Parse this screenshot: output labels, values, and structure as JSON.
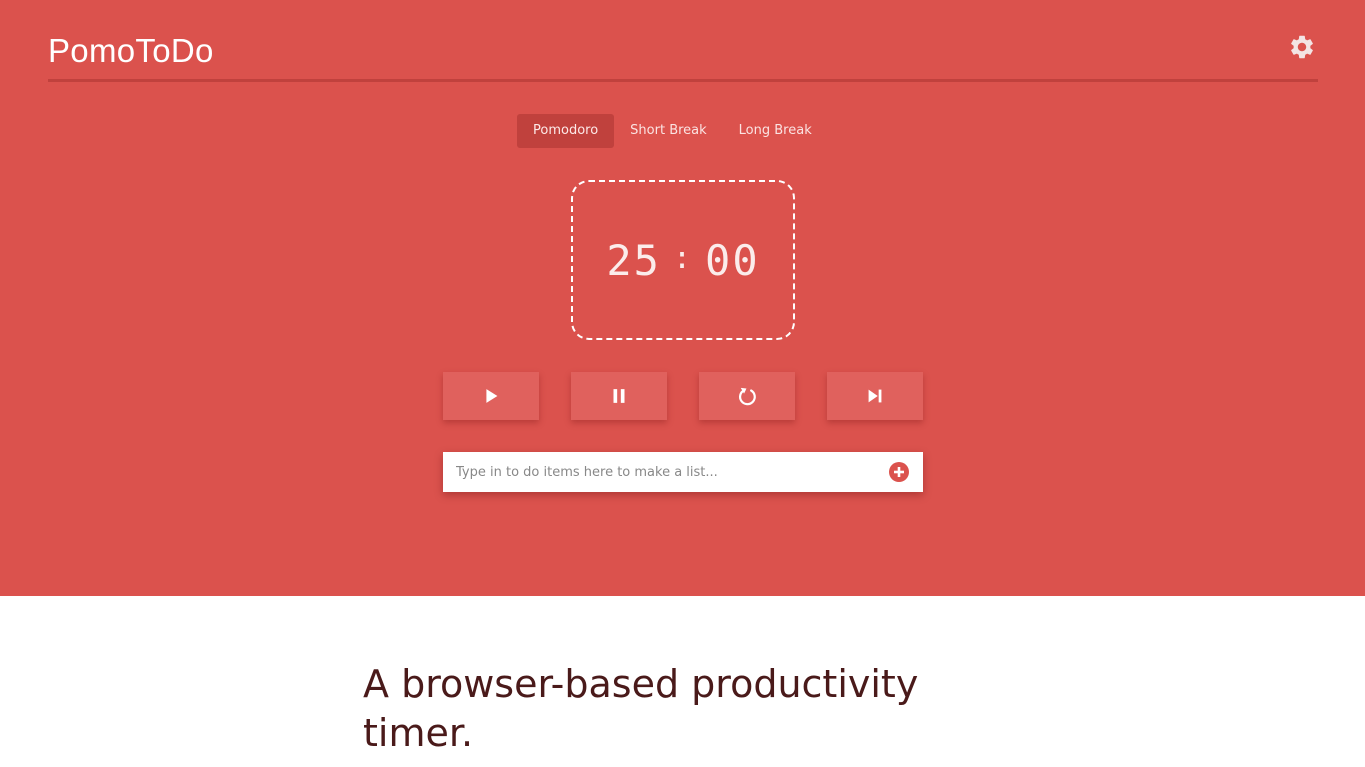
{
  "header": {
    "brand_part1": "Pomo",
    "brand_part2": "ToDo",
    "settings_icon": "gear-icon"
  },
  "tabs": [
    {
      "label": "Pomodoro",
      "active": true
    },
    {
      "label": "Short Break",
      "active": false
    },
    {
      "label": "Long Break",
      "active": false
    }
  ],
  "timer": {
    "minutes": "25",
    "separator": ":",
    "seconds": "00"
  },
  "controls": [
    {
      "icon": "play-icon"
    },
    {
      "icon": "pause-icon"
    },
    {
      "icon": "reset-icon"
    },
    {
      "icon": "skip-icon"
    }
  ],
  "todo": {
    "placeholder": "Type in to do items here to make a list...",
    "value": "",
    "add_icon": "plus-circle-icon"
  },
  "tagline": "A browser-based productivity timer.",
  "colors": {
    "primary": "#db524d",
    "primary_dark": "#c0413d",
    "button": "#e0615d",
    "text_dark": "#4a1a1a"
  }
}
